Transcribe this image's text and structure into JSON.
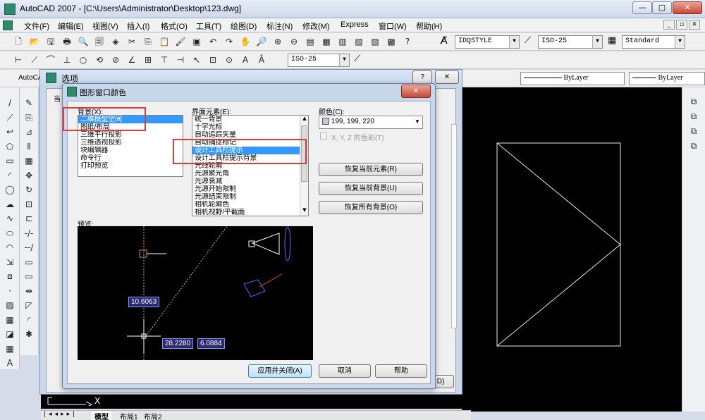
{
  "window": {
    "title": "AutoCAD 2007 - [C:\\Users\\Administrator\\Desktop\\123.dwg]"
  },
  "menu": [
    "文件(F)",
    "编辑(E)",
    "视图(V)",
    "插入(I)",
    "格式(O)",
    "工具(T)",
    "绘图(D)",
    "标注(N)",
    "修改(M)",
    "Express",
    "窗口(W)",
    "帮助(H)"
  ],
  "toolbar": {
    "textstyle": "IDQSTYLE",
    "dimstyle": "ISO-25",
    "tablestyle": "Standard",
    "dimstyle2": "ISO-25",
    "linetype1": "ByLayer",
    "linetype2": "ByLayer",
    "layer_label": "AutoCA"
  },
  "options_dialog": {
    "title": "选项",
    "help": "?",
    "close": "✕",
    "partial": "当"
  },
  "color_dialog": {
    "title": "图形窗口颜色",
    "close": "✕",
    "context_label": "背景(X):",
    "contexts": [
      "二维模型空间",
      "图纸/布局",
      "三维平行投影",
      "三维透视投影",
      "块编辑器",
      "命令行",
      "打印预览"
    ],
    "selected_context": 0,
    "element_label": "界面元素(E):",
    "elements": [
      "统一背景",
      "十字光标",
      "自动追踪矢量",
      "自动捕捉标记",
      "设计工具栏提示",
      "设计工具栏提示背景",
      "光线轮廓",
      "光源聚光角",
      "光源衰减",
      "光源开始限制",
      "光源结束限制",
      "相机轮廓色",
      "相机视野/平截面"
    ],
    "selected_element": 4,
    "color_label": "颜色(C):",
    "color_value": "199, 199, 220",
    "color_swatch": "#c7c7dc",
    "tint_checkbox": "X, Y, Z 的色彩(T)",
    "restore_element": "恢复当前元素(R)",
    "restore_context": "恢复当前背景(U)",
    "restore_all": "恢复所有背景(O)",
    "preview_label": "预览:",
    "preview_values": [
      "10.6063",
      "28.2280",
      "6.0884"
    ],
    "apply_close": "应用并关闭(A)",
    "cancel": "取消",
    "help": "帮助"
  },
  "command_line": {
    "prompt": "X"
  },
  "layout_tabs": [
    "模型",
    "布局1",
    "布局2"
  ],
  "colors": {
    "highlight": "#3399ff",
    "annotation": "#e03c3c"
  }
}
